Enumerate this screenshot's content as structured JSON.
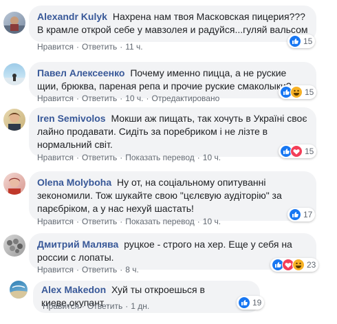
{
  "comments": [
    {
      "author": "Alexandr Kulyk",
      "text": "Нахрена нам твоя Масковская пицерия???В крамле открой себе у мавзолея и радуйся...гуляй вальсом",
      "actions": [
        "Нравится",
        "Ответить",
        "11 ч."
      ],
      "reactions": [
        "like"
      ],
      "count": "15"
    },
    {
      "author": "Павел Алексеенко",
      "text": "Почему именно пицца, а не руские щии, брюква, пареная репа и прочие руские смаколыки?",
      "actions": [
        "Нравится",
        "Ответить",
        "10 ч.",
        "Отредактировано"
      ],
      "reactions": [
        "like",
        "haha"
      ],
      "count": "15"
    },
    {
      "author": "Iren Semivolos",
      "text": "Мокши аж пищать, так хочуть в Україні своє лайно продавати. Сидіть за поребриком і не лізте в нормальний світ.",
      "actions": [
        "Нравится",
        "Ответить",
        "Показать перевод",
        "10 ч."
      ],
      "reactions": [
        "like",
        "love"
      ],
      "count": "15"
    },
    {
      "author": "Olena Molyboha",
      "text": "Ну от, на соціальному опитуванні зекономили. Тож шукайте свою \"цєлєвую аудіторію\" за парєбріком, а у нас нехуй шастать!",
      "actions": [
        "Нравится",
        "Ответить",
        "Показать перевод",
        "10 ч."
      ],
      "reactions": [
        "like"
      ],
      "count": "17"
    },
    {
      "author": "Дмитрий Малява",
      "text": "руцкое - строго на хер. Еще у себя на россии с лопаты.",
      "actions": [
        "Нравится",
        "Ответить",
        "8 ч."
      ],
      "reactions": [
        "like",
        "love",
        "haha"
      ],
      "count": "23"
    },
    {
      "author": "Alex Makedon",
      "text": "Хуй ты откроешься в киеве,окупант .",
      "actions": [
        "Нравится",
        "Ответить",
        "1 дн."
      ],
      "reactions": [
        "like"
      ],
      "count": "19"
    }
  ],
  "colors": {
    "author": "#385898",
    "bubble": "#f2f3f5",
    "meta": "#606770",
    "like": "#1877f2",
    "love": "#f33e58",
    "haha": "#f7b125"
  }
}
